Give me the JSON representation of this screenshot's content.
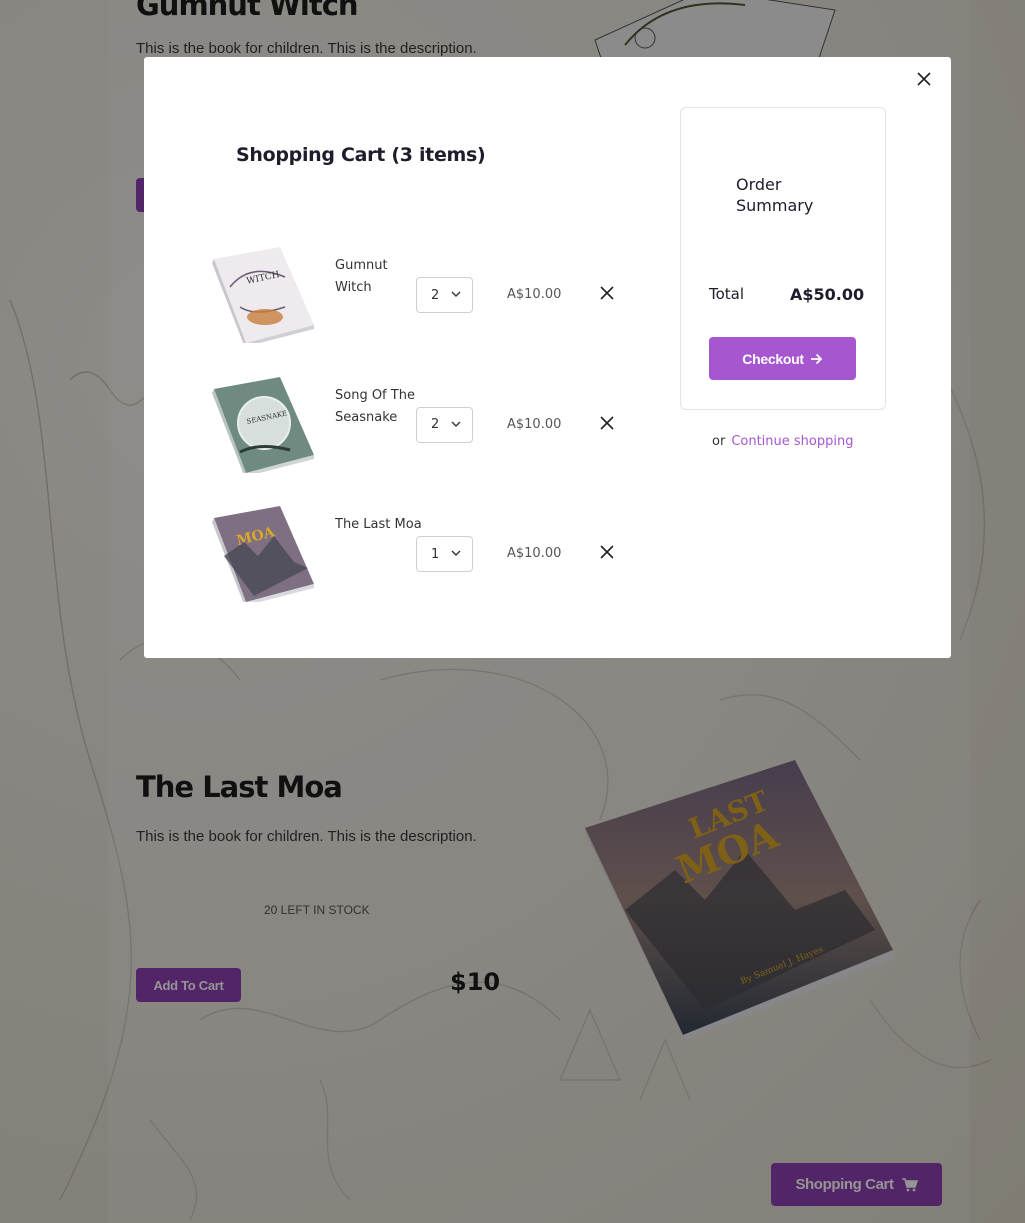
{
  "page": {
    "top_book": {
      "title": "Gumnut Witch",
      "description": "This is the book for children. This is the description."
    },
    "moa_book": {
      "title": "The Last Moa",
      "description": "This is the book for children. This is the description.",
      "stock": "20 LEFT IN STOCK",
      "add_to_cart_label": "Add To Cart",
      "price": "$10"
    },
    "floating_cart_label": "Shopping Cart"
  },
  "cart": {
    "heading": "Shopping Cart (3 items)",
    "items": [
      {
        "name": "Gumnut Witch",
        "quantity": "2",
        "price": "A$10.00",
        "cover": "gumnut-witch-cover"
      },
      {
        "name": "Song Of The Seasnake",
        "quantity": "2",
        "price": "A$10.00",
        "cover": "song-of-the-seasnake-cover"
      },
      {
        "name": "The Last Moa",
        "quantity": "1",
        "price": "A$10.00",
        "cover": "the-last-moa-cover"
      }
    ],
    "summary": {
      "title": "Order Summary",
      "total_label": "Total",
      "total_value": "A$50.00",
      "checkout_label": "Checkout"
    },
    "continue": {
      "prefix": "or",
      "link_label": "Continue shopping"
    }
  },
  "colors": {
    "accent": "#a657cf",
    "accent_dark": "#8d3fb3",
    "overlay": "rgba(0,0,0,0.42)"
  },
  "icons": {
    "close": "close-icon",
    "remove": "x-icon",
    "checkout_arrow": "arrow-right-icon",
    "cart": "shopping-cart-icon",
    "select_chevron": "chevron-down-icon"
  }
}
